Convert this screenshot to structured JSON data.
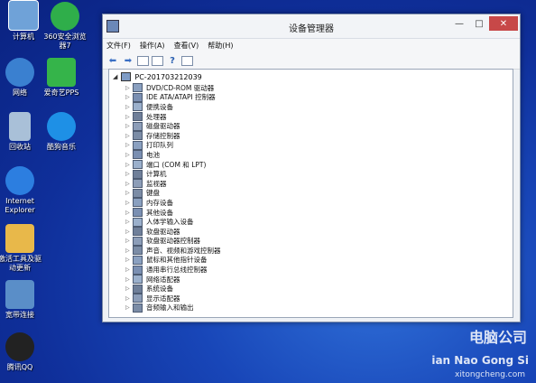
{
  "desktop_icons": [
    {
      "label": "计算机",
      "icon": "computer-icon",
      "color": "#6fa2d8"
    },
    {
      "label": "360安全浏览器7",
      "icon": "browser-360-icon",
      "color": "#2fae4a"
    },
    {
      "label": "网络",
      "icon": "network-icon",
      "color": "#3a80d0"
    },
    {
      "label": "爱奇艺PPS",
      "icon": "iqiyi-icon",
      "color": "#35b44a"
    },
    {
      "label": "回收站",
      "icon": "recycle-bin-icon",
      "color": "#a9c0d8"
    },
    {
      "label": "酷狗音乐",
      "icon": "kugou-icon",
      "color": "#1e90e6"
    },
    {
      "label": "Internet Explorer",
      "icon": "ie-icon",
      "color": "#2c7ee0"
    },
    {
      "label": "激活工具及驱动更新",
      "icon": "activation-tool-icon",
      "color": "#e8b84a"
    },
    {
      "label": "宽带连接",
      "icon": "broadband-icon",
      "color": "#5a8ec8"
    },
    {
      "label": "腾讯QQ",
      "icon": "qq-icon",
      "color": "#222222"
    }
  ],
  "window": {
    "title": "设备管理器",
    "controls": {
      "minimize": "—",
      "maximize": "□",
      "close": "✕"
    },
    "menu": [
      "文件(F)",
      "操作(A)",
      "查看(V)",
      "帮助(H)"
    ],
    "toolbar": [
      {
        "icon": "back-arrow-icon",
        "glyph": "⬅"
      },
      {
        "icon": "forward-arrow-icon",
        "glyph": "➡"
      },
      {
        "icon": "properties-icon",
        "glyph": ""
      },
      {
        "icon": "list-view-icon",
        "glyph": ""
      },
      {
        "icon": "help-icon",
        "glyph": "?"
      },
      {
        "icon": "scan-hardware-icon",
        "glyph": ""
      }
    ],
    "tree": {
      "root": "PC-201703212039",
      "items": [
        "DVD/CD-ROM 驱动器",
        "IDE ATA/ATAPI 控制器",
        "便携设备",
        "处理器",
        "磁盘驱动器",
        "存储控制器",
        "打印队列",
        "电池",
        "端口 (COM 和 LPT)",
        "计算机",
        "监视器",
        "键盘",
        "内存设备",
        "其他设备",
        "人体学输入设备",
        "软盘驱动器",
        "软盘驱动器控制器",
        "声音、视频和游戏控制器",
        "鼠标和其他指针设备",
        "通用串行总线控制器",
        "网络适配器",
        "系统设备",
        "显示适配器",
        "音频输入和输出"
      ]
    }
  },
  "watermark": {
    "line1": "电脑公司",
    "line2": "ian Nao Gong Si",
    "line3": "xitongcheng.com"
  },
  "colors": {
    "desktop_bg": "#1846b8",
    "close_button": "#c74848"
  }
}
